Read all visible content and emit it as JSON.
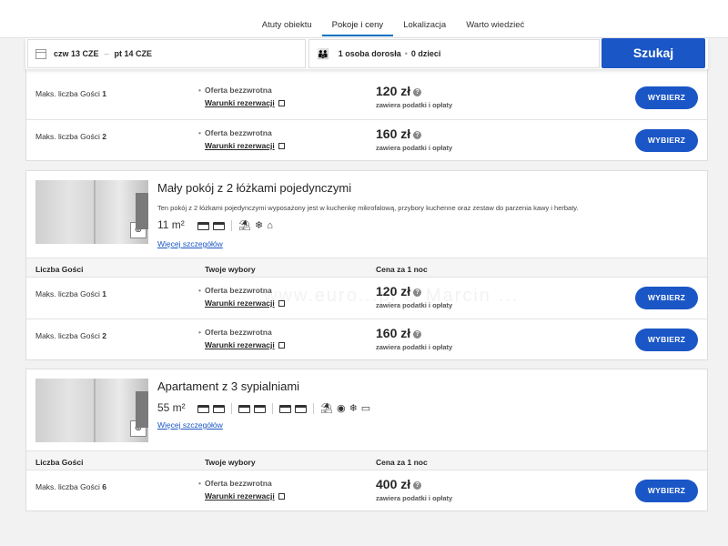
{
  "nav": {
    "tabs": [
      {
        "label": "Atuty obiektu"
      },
      {
        "label": "Pokoje i ceny"
      },
      {
        "label": "Lokalizacja"
      },
      {
        "label": "Warto wiedzieć"
      }
    ],
    "active_tab": "Pokoje i ceny"
  },
  "search": {
    "checkin": "czw 13 CZE",
    "separator": "–",
    "checkout": "pt 14 CZE",
    "adults": "1 osoba dorosła",
    "dot": "•",
    "children": "0 dzieci",
    "button": "Szukaj"
  },
  "common": {
    "offer": "Oferta bezzwrotna",
    "terms": "Warunki rezerwacji",
    "taxes": "zawiera podatki i opłaty",
    "choose": "WYBIERZ",
    "guests_prefix": "Maks. liczba Gości",
    "details": "Więcej szczegółów",
    "th_guests": "Liczba Gości",
    "th_choices": "Twoje wybory",
    "th_price": "Cena za 1 noc"
  },
  "room1_rows": [
    {
      "max": "1",
      "price": "120 zł"
    },
    {
      "max": "2",
      "price": "160 zł"
    }
  ],
  "room2": {
    "title": "Mały pokój z 2 łóżkami pojedynczymi",
    "description": "Ten pokój z 2 łóżkami pojedynczymi wyposażony jest w kuchenkę mikrofalową, przybory kuchenne oraz zestaw do parzenia kawy i herbaty.",
    "size": "11 m²",
    "rows": [
      {
        "max": "1",
        "price": "120 zł"
      },
      {
        "max": "2",
        "price": "160 zł"
      }
    ]
  },
  "room3": {
    "title": "Apartament z 3 sypialniami",
    "size": "55 m²",
    "rows": [
      {
        "max": "6",
        "price": "400 zł"
      }
    ]
  },
  "watermark": "www.euro...pl  © Marcin ..."
}
